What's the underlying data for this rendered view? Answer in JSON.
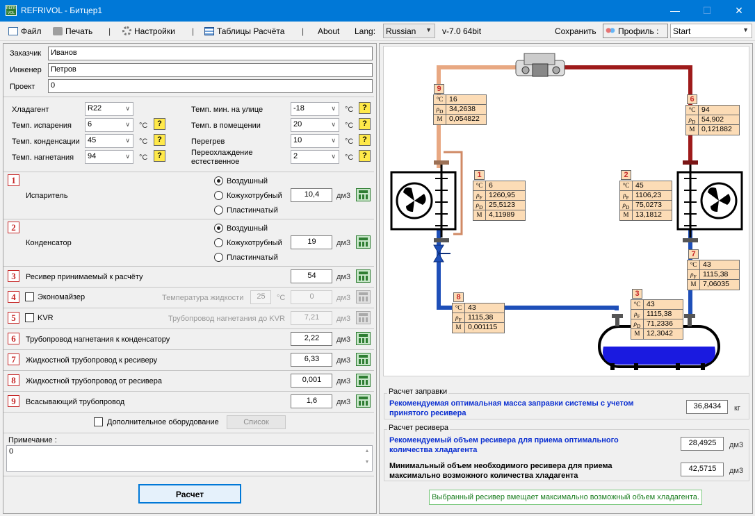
{
  "window": {
    "title": "REFRIVOL - Битцер1",
    "logo_text": "REFRI VOL",
    "min": "—",
    "max": "☐",
    "close": "✕"
  },
  "menu": {
    "file": "Файл",
    "print": "Печать",
    "settings": "Настройки",
    "tables": "Таблицы Расчёта",
    "sep": "|",
    "about": "About",
    "lang_label": "Lang:",
    "lang_value": "Russian",
    "version": "v-7.0 64bit",
    "save": "Сохранить",
    "profile": "Профиль :",
    "profile_value": "Start"
  },
  "customer": {
    "zakazchik_label": "Заказчик",
    "zakazchik": "Иванов",
    "engineer_label": "Инженер",
    "engineer": "Петров",
    "project_label": "Проект",
    "project": "0"
  },
  "params": {
    "refrigerant_label": "Хладагент",
    "refrigerant": "R22",
    "t_evap_label": "Темп. испарения",
    "t_evap": "6",
    "t_cond_label": "Темп. конденсации",
    "t_cond": "45",
    "t_disch_label": "Темп. нагнетания",
    "t_disch": "94",
    "t_out_min_label": "Темп. мин. на улице",
    "t_out_min": "-18",
    "t_room_label": "Темп. в помещении",
    "t_room": "20",
    "superheat_label": "Перегрев",
    "superheat": "10",
    "subcool_label": "Переохлаждение естественное",
    "subcool": "2",
    "unit_c": "°С",
    "hint": "?"
  },
  "evaporator": {
    "num": "1",
    "label": "Испаритель",
    "opt1": "Воздушный",
    "opt2": "Кожухотрубный",
    "opt3": "Пластинчатый",
    "value": "10,4",
    "unit": "дм3"
  },
  "condenser": {
    "num": "2",
    "label": "Конденсатор",
    "opt1": "Воздушный",
    "opt2": "Кожухотрубный",
    "opt3": "Пластинчатый",
    "value": "19",
    "unit": "дм3"
  },
  "receiver": {
    "num": "3",
    "label": "Ресивер принимаемый к расчёту",
    "value": "54",
    "unit": "дм3"
  },
  "economizer": {
    "num": "4",
    "label": "Экономайзер",
    "liq_temp_label": "Температура жидкости",
    "liq_temp": "25",
    "unit_c": "°С",
    "value": "0",
    "unit": "дм3"
  },
  "kvr": {
    "num": "5",
    "label": "KVR",
    "pipe_label": "Трубопровод нагнетания до KVR",
    "value": "7,21",
    "unit": "дм3"
  },
  "pipe6": {
    "num": "6",
    "label": "Трубопровод нагнетания к конденсатору",
    "value": "2,22",
    "unit": "дм3"
  },
  "pipe7": {
    "num": "7",
    "label": "Жидкостной трубопровод к ресиверу",
    "value": "6,33",
    "unit": "дм3"
  },
  "pipe8": {
    "num": "8",
    "label": "Жидкостной трубопровод от ресивера",
    "value": "0,001",
    "unit": "дм3"
  },
  "pipe9": {
    "num": "9",
    "label": "Всасывающий трубопровод",
    "value": "1,6",
    "unit": "дм3"
  },
  "extra": {
    "label": "Дополнительное оборудование",
    "list_btn": "Список"
  },
  "note": {
    "label": "Примечание :",
    "value": "0"
  },
  "calc_btn": "Расчет",
  "points": {
    "p9": {
      "num": "9",
      "t": "16",
      "rho": "34,2638",
      "m": "0,054822",
      "sub": "D"
    },
    "p6": {
      "num": "6",
      "t": "94",
      "rho": "54,902",
      "m": "0,121882",
      "sub": "D"
    },
    "p1": {
      "num": "1",
      "t": "6",
      "rhoF": "1260,95",
      "rhoD": "25,5123",
      "m": "4,11989"
    },
    "p2": {
      "num": "2",
      "t": "45",
      "rhoF": "1106,23",
      "rhoD": "75,0273",
      "m": "13,1812"
    },
    "p7": {
      "num": "7",
      "t": "43",
      "rhoF": "1115,38",
      "m": "7,06035"
    },
    "p8": {
      "num": "8",
      "t": "43",
      "rhoF": "1115,38",
      "m": "0,001115"
    },
    "p3": {
      "num": "3",
      "t": "43",
      "rhoF": "1115,38",
      "rhoD": "71,2336",
      "m": "12,3042"
    },
    "sym_t": "°C",
    "sym_rho": "ρ",
    "sym_m": "M",
    "sub_f": "F",
    "sub_d": "D"
  },
  "charge": {
    "title": "Расчет заправки",
    "text": "Рекомендуемая оптимальная масса заправки системы с учетом принятого ресивера",
    "value": "36,8434",
    "unit": "кг"
  },
  "receiver_calc": {
    "title": "Расчет ресивера",
    "text1": "Рекомендуемый объем ресивера для приема оптимального количества хладагента",
    "value1": "28,4925",
    "unit1": "дм3",
    "text2": "Минимальный объем необходимого ресивера для приема максимально возможного количества хладагента",
    "value2": "42,5715",
    "unit2": "дм3"
  },
  "status": "Выбранный ресивер вмещает максимально возможный объем хладагента."
}
